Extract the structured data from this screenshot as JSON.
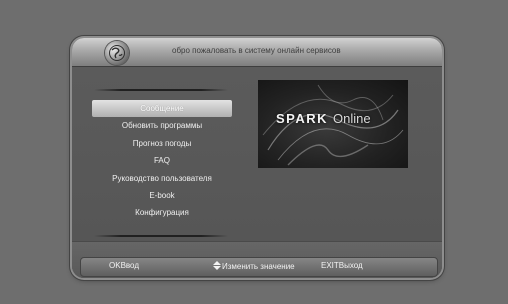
{
  "header": {
    "title": "обро пожаловать в систему онлайн сервисов",
    "icon": "globe-icon"
  },
  "menu": {
    "items": [
      {
        "label": "Сообщение",
        "selected": true
      },
      {
        "label": "Обновить программы",
        "selected": false
      },
      {
        "label": "Прогноз погоды",
        "selected": false
      },
      {
        "label": "FAQ",
        "selected": false
      },
      {
        "label": "Руководство пользователя",
        "selected": false
      },
      {
        "label": "E-book",
        "selected": false
      },
      {
        "label": "Конфигурация",
        "selected": false
      }
    ]
  },
  "preview": {
    "logo_main": "SPARK",
    "logo_sub": "Online"
  },
  "footer": {
    "ok_key": "OK",
    "ok_label": "Ввод",
    "change_icon": "up-down-arrow-icon",
    "change_label": "Изменить значение",
    "exit_key": "EXIT",
    "exit_label": "Выход"
  },
  "colors": {
    "background": "#6e6e6e",
    "panel": "#5a5a5a",
    "selection": "#d0d0d0",
    "text": "#efefef"
  }
}
